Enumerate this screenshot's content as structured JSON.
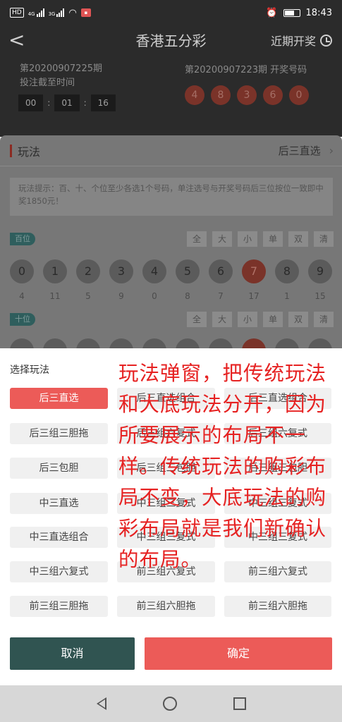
{
  "status_bar": {
    "network_label": "HD",
    "sig1": "4G",
    "sig2": "3G",
    "time": "18:43",
    "icons": [
      "hd-icon",
      "signal-icon",
      "wifi-icon",
      "app-notification-icon",
      "alarm-icon",
      "battery-icon"
    ]
  },
  "header": {
    "back_glyph": "<",
    "title": "香港五分彩",
    "recent_label": "近期开奖"
  },
  "info": {
    "current_period": "第20200907225期",
    "deadline_label": "投注截至时间",
    "countdown": [
      "00",
      "01",
      "16"
    ],
    "prev_period_label": "第20200907223期 开奖号码",
    "prev_numbers": [
      "4",
      "8",
      "3",
      "6",
      "0"
    ]
  },
  "panel": {
    "play_label": "玩法",
    "current_play": "后三直选",
    "tip": "玩法提示：百、十、个位至少各选1个号码，单注选号与开奖号码后三位按位一致即中奖1850元！",
    "rows": [
      {
        "position": "百位",
        "quick": [
          "全",
          "大",
          "小",
          "单",
          "双",
          "清"
        ],
        "numbers": [
          "0",
          "1",
          "2",
          "3",
          "4",
          "5",
          "6",
          "7",
          "8",
          "9"
        ],
        "selected": "7",
        "miss": [
          "4",
          "11",
          "5",
          "9",
          "0",
          "8",
          "7",
          "17",
          "1",
          "15"
        ]
      },
      {
        "position": "十位",
        "quick": [
          "全",
          "大",
          "小",
          "单",
          "双",
          "清"
        ]
      }
    ]
  },
  "modal": {
    "title": "选择玩法",
    "options_left": [
      "后三直选",
      "后三组三胆拖",
      "后三包胆",
      "中三直选",
      "中三直选组合",
      "中三组六复式",
      "前三组三胆拖"
    ],
    "options_right": [
      "后三直选组合",
      "后三组六复式",
      "后三组三包胆",
      "中三组三复式",
      "中三组三复式",
      "前三组六复式",
      "前三组六胆拖"
    ],
    "active_option": "后三直选",
    "cancel_label": "取消",
    "confirm_label": "确定"
  },
  "annotation": {
    "text": "玩法弹窗，把传统玩法和大底玩法分开，因为所要展示的布局不一样。传统玩法的购彩布局不变，大底玩法的购彩布局就是我们新确认的布局。",
    "color": "#e62222"
  },
  "colors": {
    "accent": "#ec5b58",
    "cancel": "#305451",
    "dark_bg": "#2b2b2b"
  }
}
